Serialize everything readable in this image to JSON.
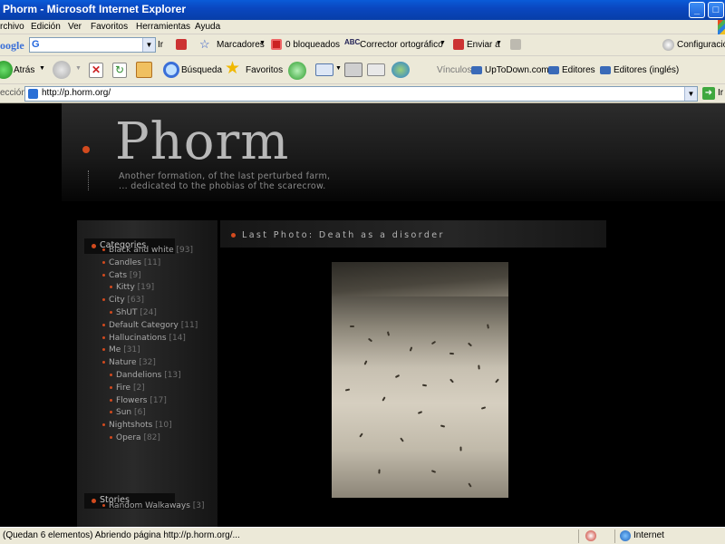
{
  "window": {
    "title": "Phorm - Microsoft Internet Explorer"
  },
  "menu": {
    "items": [
      "rchivo",
      "Edición",
      "Ver",
      "Favoritos",
      "Herramientas",
      "Ayuda"
    ]
  },
  "google_toolbar": {
    "logo": "oogle",
    "search_value": "G",
    "go": "Ir",
    "bookmarks": "Marcadores",
    "blocked": "0 bloqueados",
    "spellcheck": "Corrector ortográfico",
    "send": "Enviar a",
    "settings": "Configuración"
  },
  "std_toolbar": {
    "back": "Atrás",
    "search": "Búsqueda",
    "favorites": "Favoritos",
    "links_label": "Vínculos",
    "links": [
      "UpToDown.com",
      "Editores",
      "Editores (inglés)"
    ]
  },
  "address": {
    "label": "ección",
    "url": "http://p.horm.org/",
    "go": "Ir"
  },
  "site": {
    "title": "Phorm",
    "tagline_1": "Another formation, of the last perturbed farm,",
    "tagline_2": "... dedicated to the phobias of the scarecrow."
  },
  "sidebar": {
    "categories_title": "Categories",
    "categories": [
      {
        "name": "Black and white",
        "count": "[93]",
        "level": 0
      },
      {
        "name": "Candles",
        "count": "[11]",
        "level": 0
      },
      {
        "name": "Cats",
        "count": "[9]",
        "level": 0
      },
      {
        "name": "Kitty",
        "count": "[19]",
        "level": 1
      },
      {
        "name": "City",
        "count": "[63]",
        "level": 0
      },
      {
        "name": "ShUT",
        "count": "[24]",
        "level": 1
      },
      {
        "name": "Default Category",
        "count": "[11]",
        "level": 0
      },
      {
        "name": "Hallucinations",
        "count": "[14]",
        "level": 0
      },
      {
        "name": "Me",
        "count": "[31]",
        "level": 0
      },
      {
        "name": "Nature",
        "count": "[32]",
        "level": 0
      },
      {
        "name": "Dandelions",
        "count": "[13]",
        "level": 1
      },
      {
        "name": "Fire",
        "count": "[2]",
        "level": 1
      },
      {
        "name": "Flowers",
        "count": "[17]",
        "level": 1
      },
      {
        "name": "Sun",
        "count": "[6]",
        "level": 1
      },
      {
        "name": "Nightshots",
        "count": "[10]",
        "level": 0
      },
      {
        "name": "Opera",
        "count": "[82]",
        "level": 1
      }
    ],
    "stories_title": "Stories",
    "stories": [
      {
        "name": "Random Walkaways",
        "count": "[3]",
        "level": 0
      }
    ]
  },
  "content": {
    "title": "Last Photo: Death as a disorder"
  },
  "status": {
    "text": "(Quedan 6 elementos) Abriendo página http://p.horm.org/...",
    "zone": "Internet"
  },
  "colors": {
    "accent": "#d24a1e",
    "xp_blue": "#0a47c0"
  }
}
